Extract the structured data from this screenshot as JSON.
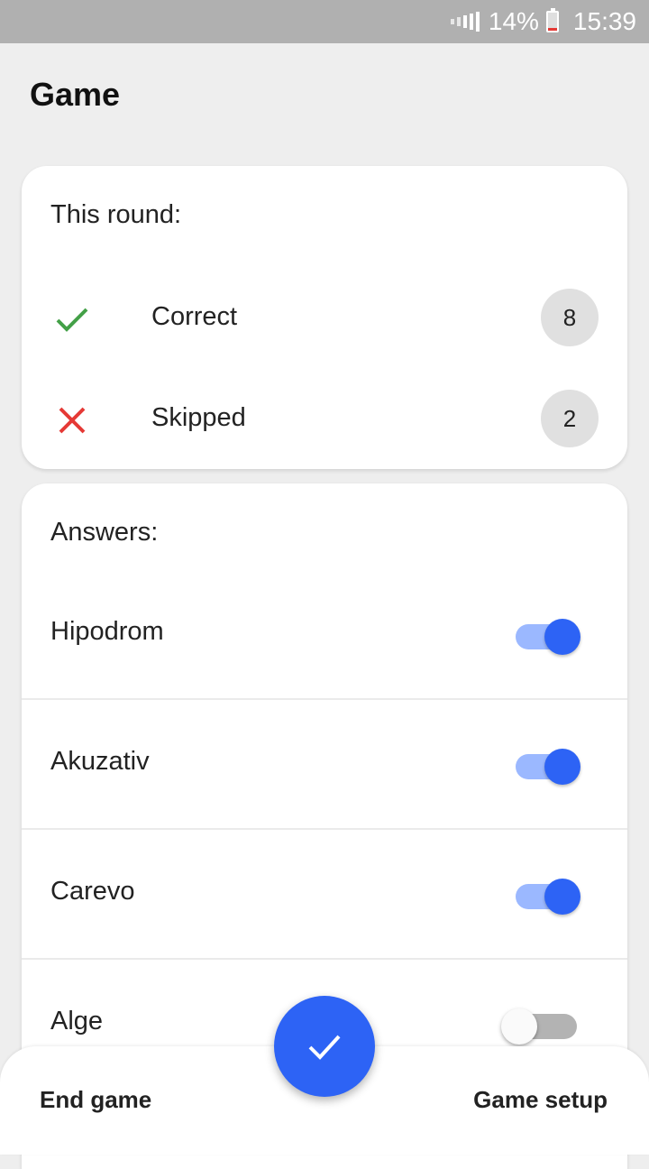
{
  "status_bar": {
    "battery": "14%",
    "time": "15:39"
  },
  "page": {
    "title": "Game"
  },
  "round": {
    "heading": "This round:",
    "correct": {
      "label": "Correct",
      "count": "8"
    },
    "skipped": {
      "label": "Skipped",
      "count": "2"
    }
  },
  "answers": {
    "heading": "Answers:",
    "items": [
      {
        "label": "Hipodrom",
        "checked": true
      },
      {
        "label": "Akuzativ",
        "checked": true
      },
      {
        "label": "Carevo",
        "checked": true
      },
      {
        "label": "Alge",
        "checked": false
      }
    ]
  },
  "bottom_bar": {
    "end_label": "End game",
    "setup_label": "Game setup"
  },
  "colors": {
    "accent": "#2d63f5",
    "correct": "#43a047",
    "skipped": "#e53935"
  }
}
